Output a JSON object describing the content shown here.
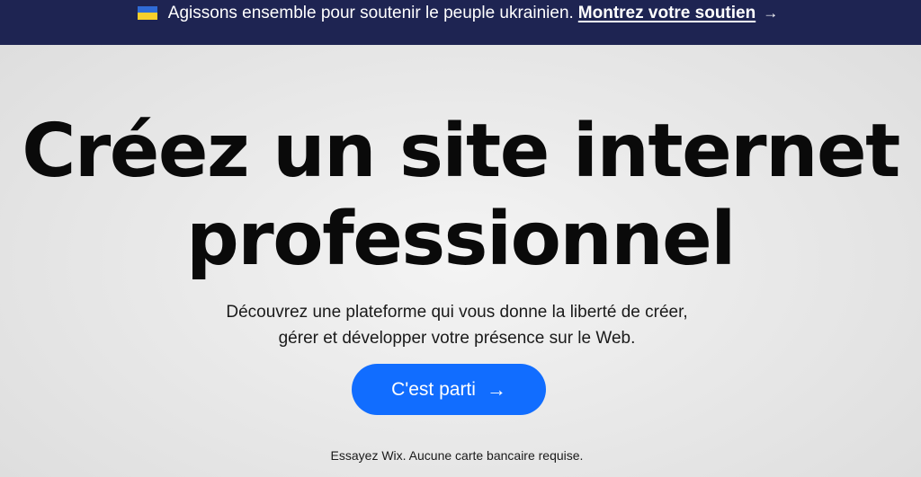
{
  "banner": {
    "message": "Agissons ensemble pour soutenir le peuple ukrainien.",
    "link_label": "Montrez votre soutien",
    "link_arrow": "→",
    "background_color": "#1e2452",
    "flag_icon": "ukraine-flag-icon"
  },
  "hero": {
    "title_line1": "Créez un site internet",
    "title_line2": "professionnel",
    "subtitle_line1": "Découvrez une plateforme qui vous donne la liberté de créer,",
    "subtitle_line2": "gérer et développer votre présence sur le Web.",
    "cta_label": "C'est parti",
    "cta_arrow": "→",
    "cta_color": "#116dff",
    "note": "Essayez Wix. Aucune carte bancaire requise."
  }
}
